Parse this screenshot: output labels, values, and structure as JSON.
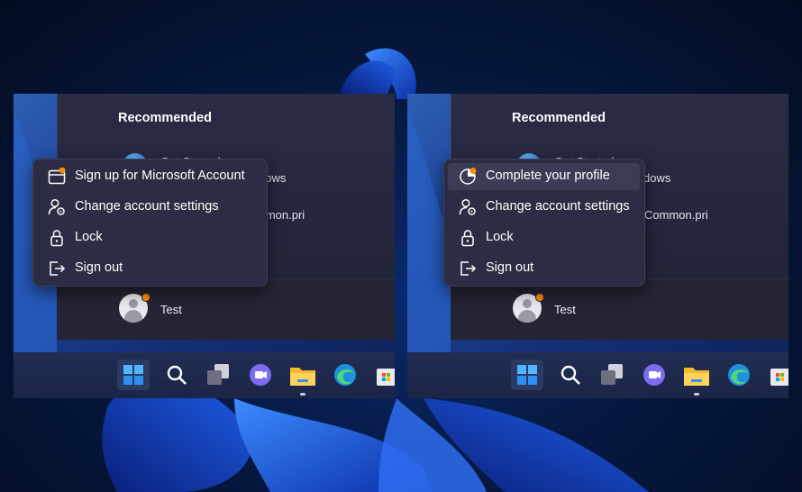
{
  "panels": [
    {
      "recommended_title": "Recommended",
      "rec_items": [
        "Get Started",
        "dows",
        "mmon.pri"
      ],
      "user_name": "Test",
      "context_menu": [
        {
          "label": "Sign up for Microsoft Account",
          "icon": "account-badge-icon"
        },
        {
          "label": "Change account settings",
          "icon": "user-settings-icon"
        },
        {
          "label": "Lock",
          "icon": "lock-icon"
        },
        {
          "label": "Sign out",
          "icon": "sign-out-icon"
        }
      ]
    },
    {
      "recommended_title": "Recommended",
      "rec_items": [
        "Get Started",
        "dows",
        "Common.pri"
      ],
      "user_name": "Test",
      "context_menu": [
        {
          "label": "Complete your profile",
          "icon": "profile-progress-icon"
        },
        {
          "label": "Change account settings",
          "icon": "user-settings-icon"
        },
        {
          "label": "Lock",
          "icon": "lock-icon"
        },
        {
          "label": "Sign out",
          "icon": "sign-out-icon"
        }
      ]
    }
  ],
  "taskbar_icons": [
    "windows-start-icon",
    "search-icon",
    "task-view-icon",
    "teams-chat-icon",
    "file-explorer-icon",
    "edge-icon",
    "store-icon"
  ],
  "colors": {
    "accent_notification": "#ff8c00",
    "menu_bg": "#2c2d44"
  }
}
